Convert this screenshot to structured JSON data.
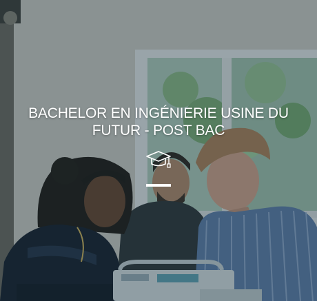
{
  "card": {
    "title": "BACHELOR EN INGÉNIERIE USINE DU FUTUR - POST BAC",
    "icon": "graduation-cap-icon",
    "overlay_color": "#19323c",
    "accent": "#ffffff"
  }
}
